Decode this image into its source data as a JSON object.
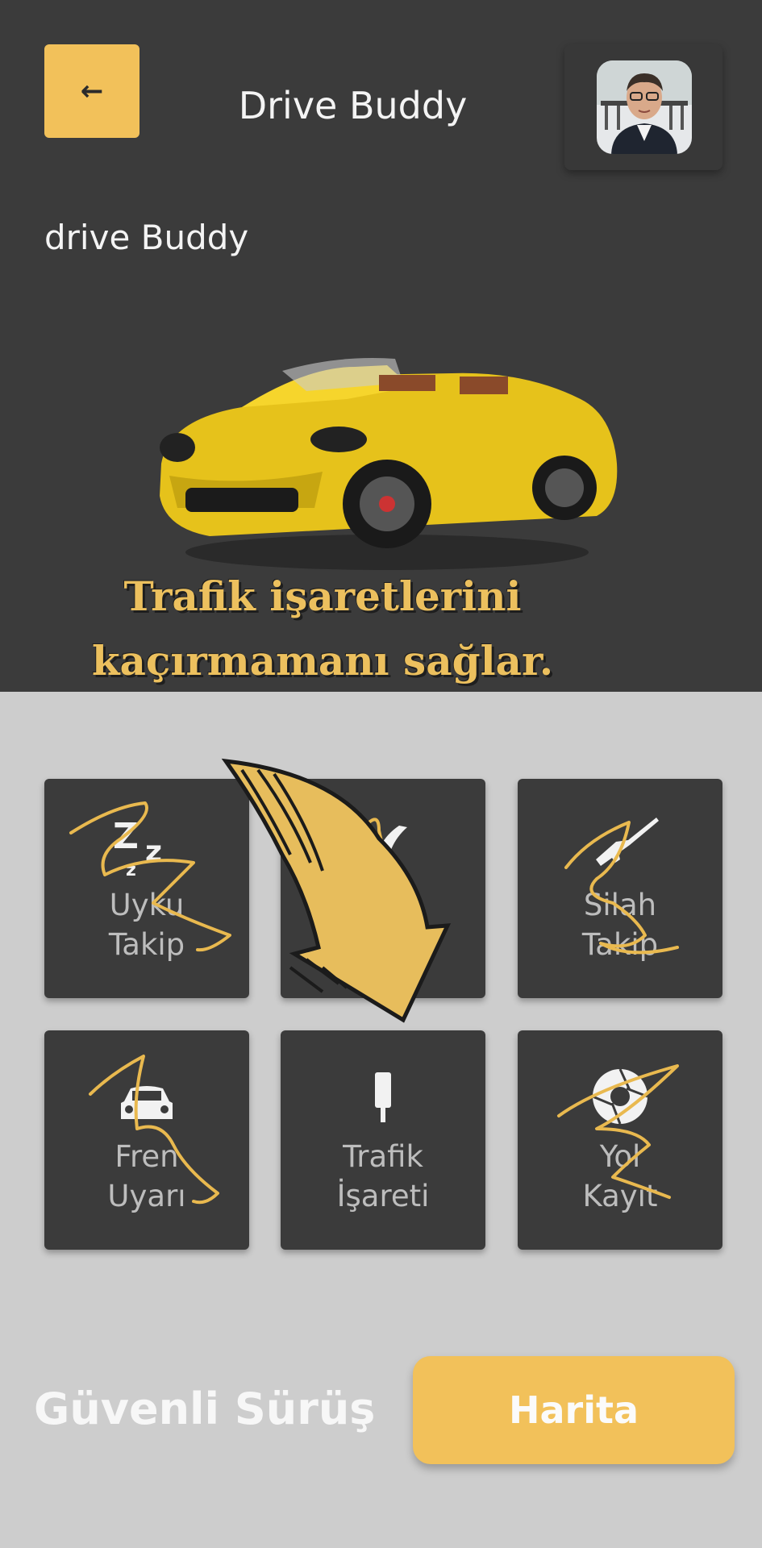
{
  "header": {
    "back_icon": "arrow-left-icon",
    "title": "Drive Buddy",
    "avatar": "user-avatar"
  },
  "hero": {
    "subtitle": "drive Buddy",
    "promo_line1": "Trafik işaretlerini",
    "promo_line2": "kaçırmamanı sağlar."
  },
  "features": [
    {
      "label": "Uyku\nTakip",
      "icon": "sleep-zzz-icon"
    },
    {
      "label": "",
      "icon": "lane-road-icon"
    },
    {
      "label": "Silah\nTakip",
      "icon": "rifle-icon"
    },
    {
      "label": "Fren\nUyarı",
      "icon": "car-front-icon"
    },
    {
      "label": "Trafik\nİşareti",
      "icon": "traffic-sign-icon"
    },
    {
      "label": "Yol\nKayıt",
      "icon": "camera-shutter-icon"
    }
  ],
  "footer": {
    "safe_drive_label": "Güvenli Sürüş",
    "map_button": "Harita"
  },
  "colors": {
    "accent": "#f2c15a",
    "dark": "#3b3b3b",
    "light_bg": "#cdcdcd"
  }
}
